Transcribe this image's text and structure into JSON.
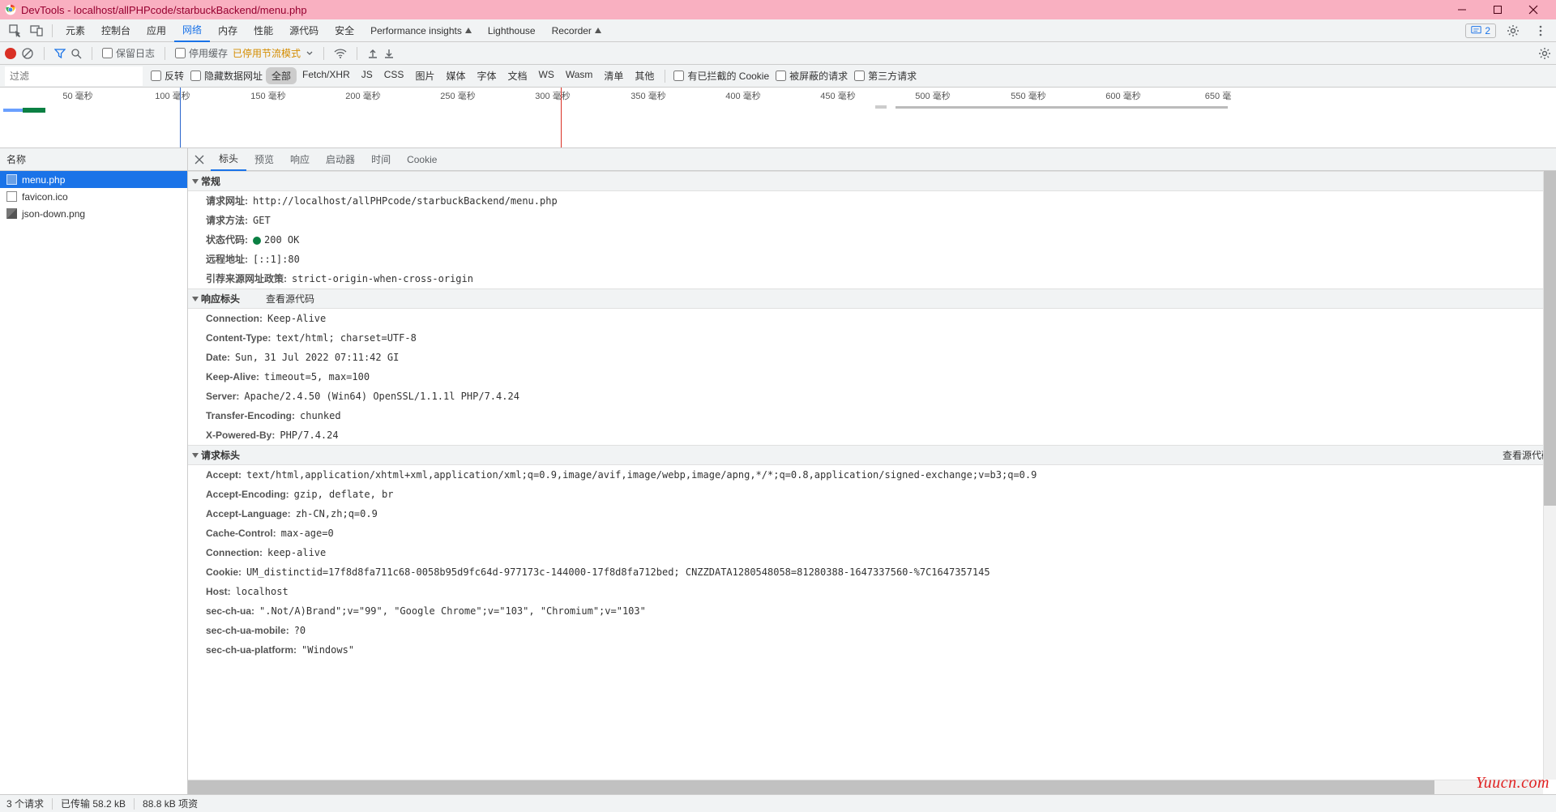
{
  "window": {
    "title": "DevTools - localhost/allPHPcode/starbuckBackend/menu.php"
  },
  "mainTabs": [
    "元素",
    "控制台",
    "应用",
    "网络",
    "内存",
    "性能",
    "源代码",
    "安全",
    "Performance insights",
    "Lighthouse",
    "Recorder"
  ],
  "mainTabsActive": "网络",
  "msgCount": "2",
  "netToolbar": {
    "preserveLog": "保留日志",
    "disableCache": "停用缓存",
    "throttling": "已停用节流模式"
  },
  "filterRow": {
    "filterPlaceholder": "过滤",
    "invert": "反转",
    "hideDataUrls": "隐藏数据网址",
    "types": [
      "全部",
      "Fetch/XHR",
      "JS",
      "CSS",
      "图片",
      "媒体",
      "字体",
      "文档",
      "WS",
      "Wasm",
      "清单",
      "其他"
    ],
    "typesActive": "全部",
    "blockedCookies": "有已拦截的 Cookie",
    "blockedRequests": "被屏蔽的请求",
    "thirdParty": "第三方请求"
  },
  "timelineTicks": [
    "50 毫秒",
    "100 毫秒",
    "150 毫秒",
    "200 毫秒",
    "250 毫秒",
    "300 毫秒",
    "350 毫秒",
    "400 毫秒",
    "450 毫秒",
    "500 毫秒",
    "550 毫秒",
    "600 毫秒",
    "650 毫"
  ],
  "reqList": {
    "header": "名称",
    "items": [
      {
        "name": "menu.php",
        "icon": "doc",
        "selected": true
      },
      {
        "name": "favicon.ico",
        "icon": "doc",
        "selected": false
      },
      {
        "name": "json-down.png",
        "icon": "img",
        "selected": false
      }
    ]
  },
  "detailTabs": [
    "标头",
    "预览",
    "响应",
    "启动器",
    "时间",
    "Cookie"
  ],
  "detailTabsActive": "标头",
  "sections": {
    "general": {
      "title": "常规",
      "rows": [
        {
          "k": "请求网址:",
          "v": "http://localhost/allPHPcode/starbuckBackend/menu.php"
        },
        {
          "k": "请求方法:",
          "v": "GET"
        },
        {
          "k": "状态代码:",
          "v": "200 OK",
          "status": true
        },
        {
          "k": "远程地址:",
          "v": "[::1]:80"
        },
        {
          "k": "引荐来源网址政策:",
          "v": "strict-origin-when-cross-origin"
        }
      ]
    },
    "response": {
      "title": "响应标头",
      "viewSource": "查看源代码",
      "rows": [
        {
          "k": "Connection:",
          "v": "Keep-Alive"
        },
        {
          "k": "Content-Type:",
          "v": "text/html; charset=UTF-8"
        },
        {
          "k": "Date:",
          "v": "Sun, 31 Jul 2022 07:11:42 GI"
        },
        {
          "k": "Keep-Alive:",
          "v": "timeout=5, max=100"
        },
        {
          "k": "Server:",
          "v": "Apache/2.4.50 (Win64) OpenSSL/1.1.1l PHP/7.4.24"
        },
        {
          "k": "Transfer-Encoding:",
          "v": "chunked"
        },
        {
          "k": "X-Powered-By:",
          "v": "PHP/7.4.24"
        }
      ]
    },
    "request": {
      "title": "请求标头",
      "viewSource": "查看源代码",
      "rows": [
        {
          "k": "Accept:",
          "v": "text/html,application/xhtml+xml,application/xml;q=0.9,image/avif,image/webp,image/apng,*/*;q=0.8,application/signed-exchange;v=b3;q=0.9"
        },
        {
          "k": "Accept-Encoding:",
          "v": "gzip, deflate, br"
        },
        {
          "k": "Accept-Language:",
          "v": "zh-CN,zh;q=0.9"
        },
        {
          "k": "Cache-Control:",
          "v": "max-age=0"
        },
        {
          "k": "Connection:",
          "v": "keep-alive"
        },
        {
          "k": "Cookie:",
          "v": "UM_distinctid=17f8d8fa711c68-0058b95d9fc64d-977173c-144000-17f8d8fa712bed; CNZZDATA1280548058=81280388-1647337560-%7C1647357145"
        },
        {
          "k": "Host:",
          "v": "localhost"
        },
        {
          "k": "sec-ch-ua:",
          "v": "\".Not/A)Brand\";v=\"99\", \"Google Chrome\";v=\"103\", \"Chromium\";v=\"103\""
        },
        {
          "k": "sec-ch-ua-mobile:",
          "v": "?0"
        },
        {
          "k": "sec-ch-ua-platform:",
          "v": "\"Windows\""
        }
      ]
    }
  },
  "statusBar": {
    "requests": "3 个请求",
    "transferred": "已传输 58.2 kB",
    "resources": "88.8 kB 项资"
  },
  "watermark": "Yuucn.com"
}
